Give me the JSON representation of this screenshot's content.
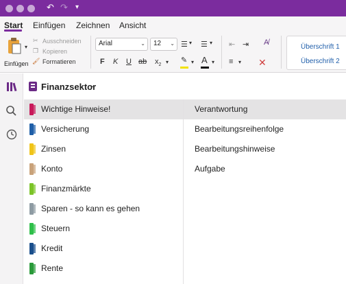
{
  "window": {
    "traffic_light_color": "#c8a8d6",
    "titlebar_color": "#7b2c9e"
  },
  "ribbon_tabs": [
    {
      "label": "Start",
      "active": true
    },
    {
      "label": "Einfügen",
      "active": false
    },
    {
      "label": "Zeichnen",
      "active": false
    },
    {
      "label": "Ansicht",
      "active": false
    }
  ],
  "clipboard": {
    "paste_label": "Einfügen",
    "cut_label": "Ausschneiden",
    "copy_label": "Kopieren",
    "format_label": "Formatieren"
  },
  "font": {
    "family_value": "Arial",
    "size_value": "12"
  },
  "styles": {
    "heading1": "Überschrift 1",
    "heading2": "Überschrift 2"
  },
  "notebook": {
    "title": "Finanzsektor"
  },
  "sections": [
    {
      "label": "Wichtige Hinweise!",
      "color": "#c8195a",
      "selected": true
    },
    {
      "label": "Versicherung",
      "color": "#1f5fa8",
      "selected": false
    },
    {
      "label": "Zinsen",
      "color": "#f0c419",
      "selected": false
    },
    {
      "label": "Konto",
      "color": "#c9a27a",
      "selected": false
    },
    {
      "label": "Finanzmärkte",
      "color": "#7cc428",
      "selected": false
    },
    {
      "label": "Sparen - so kann es gehen",
      "color": "#8e9ba3",
      "selected": false
    },
    {
      "label": "Steuern",
      "color": "#2fbf4a",
      "selected": false
    },
    {
      "label": "Kredit",
      "color": "#1a4f8c",
      "selected": false
    },
    {
      "label": "Rente",
      "color": "#2a9a3a",
      "selected": false
    }
  ],
  "pages": [
    {
      "label": "Verantwortung",
      "selected": true
    },
    {
      "label": "Bearbeitungsreihenfolge",
      "selected": false
    },
    {
      "label": "Bearbeitungshinweise",
      "selected": false
    },
    {
      "label": "Aufgabe",
      "selected": false
    }
  ]
}
